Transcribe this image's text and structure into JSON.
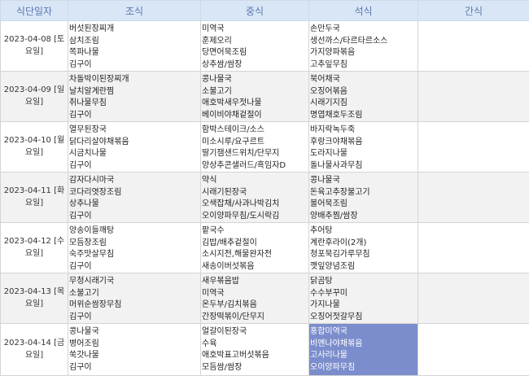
{
  "header": {
    "date": "식단일자",
    "breakfast": "조식",
    "lunch": "중식",
    "dinner": "석식",
    "snack": "간식"
  },
  "rows": [
    {
      "date": "2023-04-08 [토요일]",
      "breakfast": [
        "버섯된장찌개",
        "삼치조림",
        "쪽파나물",
        "김구이"
      ],
      "lunch": [
        "미역국",
        "훈제오리",
        "당면어묵조림",
        "상추쌈/쌈장"
      ],
      "dinner": [
        "손만두국",
        "생선까스/타르타르소스",
        "가지양파볶음",
        "고추잎무침"
      ],
      "snack": []
    },
    {
      "date": "2023-04-09 [일요일]",
      "breakfast": [
        "차돌박이된장찌개",
        "날치알계란찜",
        "취나물무침",
        "김구이"
      ],
      "lunch": [
        "콩나물국",
        "소불고기",
        "애호박새우젓나물",
        "베이비야채겉절이"
      ],
      "dinner": [
        "북어채국",
        "오징어볶음",
        "시래기지짐",
        "명엽채호두조림"
      ],
      "snack": []
    },
    {
      "date": "2023-04-10 [월요일]",
      "breakfast": [
        "열무된장국",
        "닭다리살야채볶음",
        "시금치나물",
        "김구이"
      ],
      "lunch": [
        "함박스테이크/소스",
        "미소시루/요구르트",
        "딸기잼샌드위치/단무지",
        "양상추콘샐러드/흑임자D"
      ],
      "dinner": [
        "바지락녹두죽",
        "후랑크야채볶음",
        "도라지나물",
        "돌나물사과무침"
      ],
      "snack": []
    },
    {
      "date": "2023-04-11 [화요일]",
      "breakfast": [
        "감자다시마국",
        "코다리엿장조림",
        "상추나물",
        "김구이"
      ],
      "lunch": [
        "약식",
        "시래기된장국",
        "오색잡채/사과나박김치",
        "오이양파무침/도시락김"
      ],
      "dinner": [
        "콩나물국",
        "돈육고추장불고기",
        "볼어묵조림",
        "양배추찜/쌈장"
      ],
      "snack": []
    },
    {
      "date": "2023-04-12 [수요일]",
      "breakfast": [
        "양송이들깨탕",
        "모듬장조림",
        "숙주맛살무침",
        "김구이"
      ],
      "lunch": [
        "팥국수",
        "김밥/배추겉절이",
        "소시지전,해물완자전",
        "새송이버섯볶음"
      ],
      "dinner": [
        "추어탕",
        "계란후라이(2개)",
        "청포묵김가루무침",
        "깻잎양념조림"
      ],
      "snack": []
    },
    {
      "date": "2023-04-13 [목요일]",
      "breakfast": [
        "무청시래기국",
        "소불고기",
        "머위순쌈장무침",
        "김구이"
      ],
      "lunch": [
        "새우볶음밥",
        "미역국",
        "온두부/김치볶음",
        "간장떡볶이/단무지"
      ],
      "dinner": [
        "닭곰탕",
        "수수부꾸미",
        "가지나물",
        "오징어젓갈무침"
      ],
      "snack": []
    },
    {
      "date": "2023-04-14 [금요일]",
      "breakfast": [
        "콩나물국",
        "병어조림",
        "쑥갓나물",
        "김구이"
      ],
      "lunch": [
        "얼갈이된장국",
        "수육",
        "애호박표고버섯볶음",
        "모듬쌈/쌈장"
      ],
      "dinner": [
        "홍합미역국",
        "비엔나야채볶음",
        "고사리나물",
        "오이양파무침"
      ],
      "snack": []
    }
  ],
  "colors": {
    "header_bg": "#d9e6f6",
    "header_text": "#5a78b0",
    "alt_row_bg": "#f2f2f2",
    "highlight_bg": "#7b8dcc"
  }
}
